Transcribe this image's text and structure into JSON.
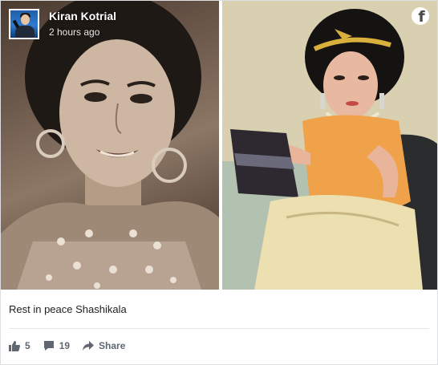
{
  "post": {
    "author": "Kiran Kotrial",
    "time": "2 hours ago",
    "caption": "Rest in peace Shashikala"
  },
  "actions": {
    "likes": "5",
    "comments": "19",
    "share_label": "Share"
  },
  "icons": {
    "brand": "facebook-icon",
    "like": "thumbs-up-icon",
    "comment": "speech-bubble-icon",
    "share": "share-arrow-icon"
  },
  "colors": {
    "text_primary": "#1c1e21",
    "text_secondary": "#606770",
    "divider": "#e5e6e9"
  }
}
